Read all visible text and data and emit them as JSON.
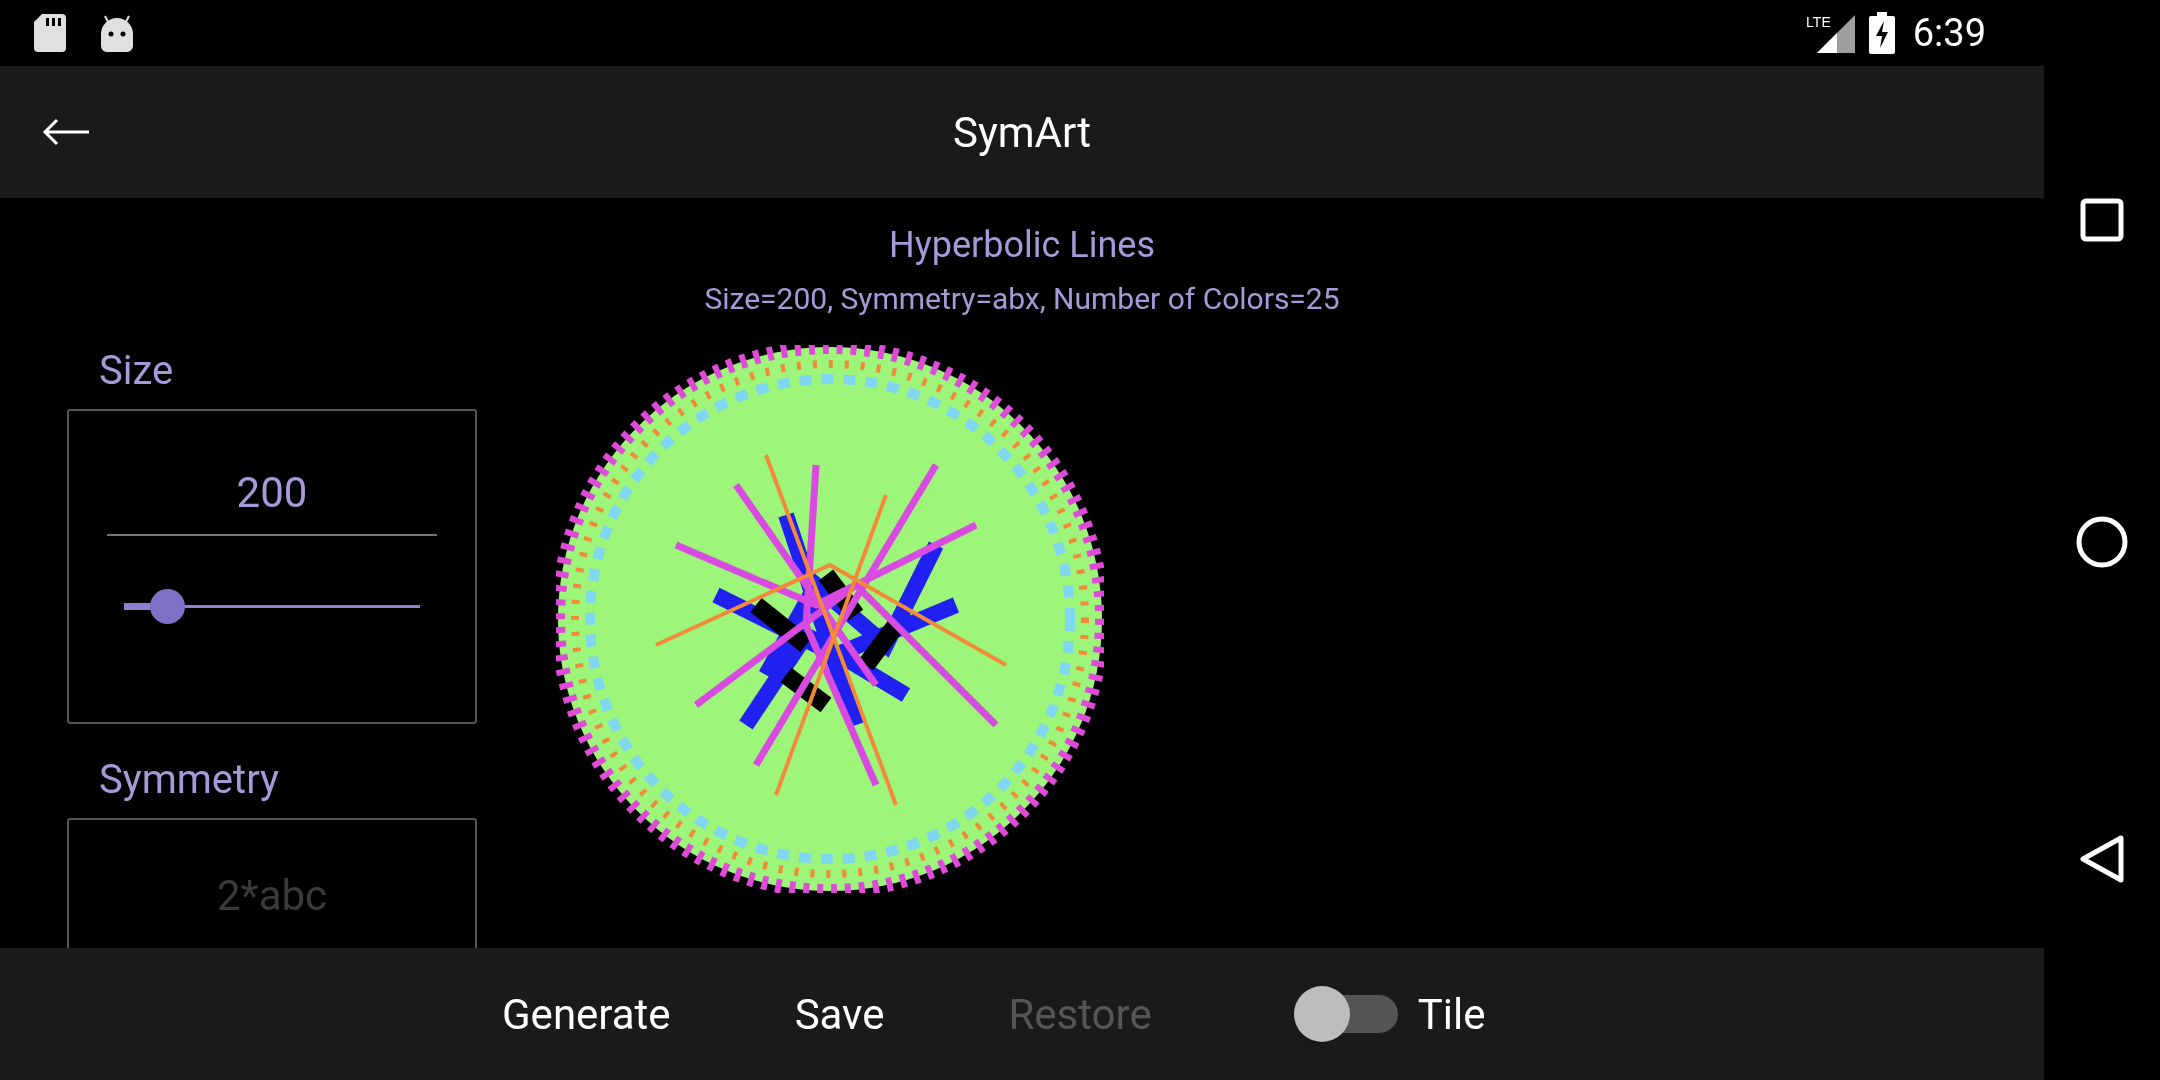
{
  "status_bar": {
    "network": "LTE",
    "time": "6:39"
  },
  "app_bar": {
    "title": "SymArt"
  },
  "header": {
    "title": "Hyperbolic Lines",
    "subtitle": "Size=200, Symmetry=abx, Number of Colors=25"
  },
  "fields": [
    {
      "kind": "slider",
      "label": "Size",
      "value": "200",
      "level": 0.145
    },
    {
      "kind": "text",
      "label": "Symmetry",
      "placeholder": "2*abc"
    }
  ],
  "actions": [
    {
      "kind": "button",
      "label": "Generate",
      "disabled": false
    },
    {
      "kind": "button",
      "label": "Save",
      "disabled": false
    },
    {
      "kind": "button",
      "label": "Restore",
      "disabled": true
    },
    {
      "kind": "switch",
      "label": "Tile",
      "on": false
    }
  ]
}
